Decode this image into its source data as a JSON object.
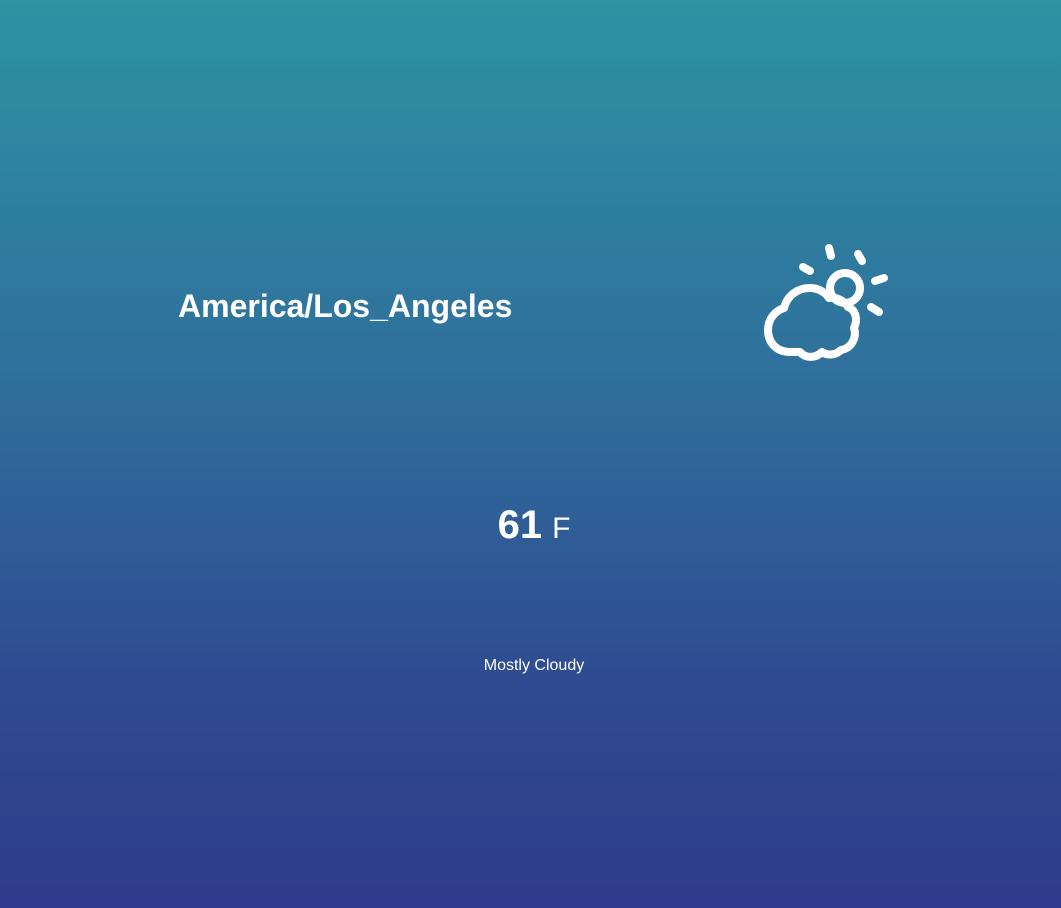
{
  "weather": {
    "location": "America/Los_Angeles",
    "temperature": "61",
    "unit": "F",
    "condition": "Mostly Cloudy",
    "icon": "partly-cloudy-day-icon"
  },
  "colors": {
    "gradient_top": "#2e93a3",
    "gradient_bottom": "#2f3b8c",
    "text": "#ffffff"
  }
}
